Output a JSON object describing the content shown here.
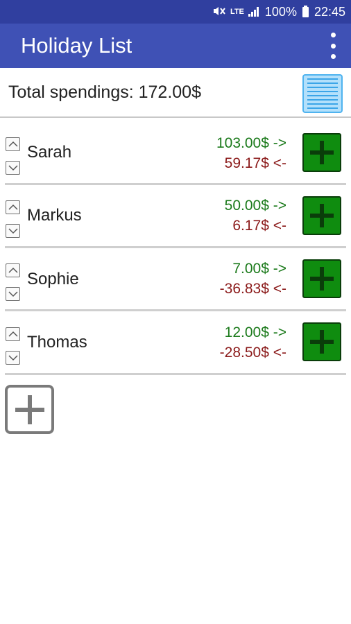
{
  "status_bar": {
    "network_label": "LTE",
    "battery": "100%",
    "time": "22:45",
    "color": "#303f9f"
  },
  "app_bar": {
    "title": "Holiday List",
    "color": "#3f51b5",
    "menu_icon": "overflow-menu-icon"
  },
  "summary": {
    "total_label": "Total spendings: 172.00$",
    "list_icon": "list-icon"
  },
  "people": [
    {
      "name": "Sarah",
      "paid": "103.00$ ->",
      "owed": "59.17$ <-"
    },
    {
      "name": "Markus",
      "paid": "50.00$ ->",
      "owed": "6.17$ <-"
    },
    {
      "name": "Sophie",
      "paid": "7.00$ ->",
      "owed": "-36.83$ <-"
    },
    {
      "name": "Thomas",
      "paid": "12.00$ ->",
      "owed": "-28.50$ <-"
    }
  ],
  "colors": {
    "paid": "#1b7a1b",
    "owed": "#8b1a1a",
    "add_button": "#0f8c0f"
  },
  "icons": {
    "move_up": "chevron-up-icon",
    "move_down": "chevron-down-icon",
    "add_expense": "plus-icon",
    "add_person": "plus-icon"
  }
}
